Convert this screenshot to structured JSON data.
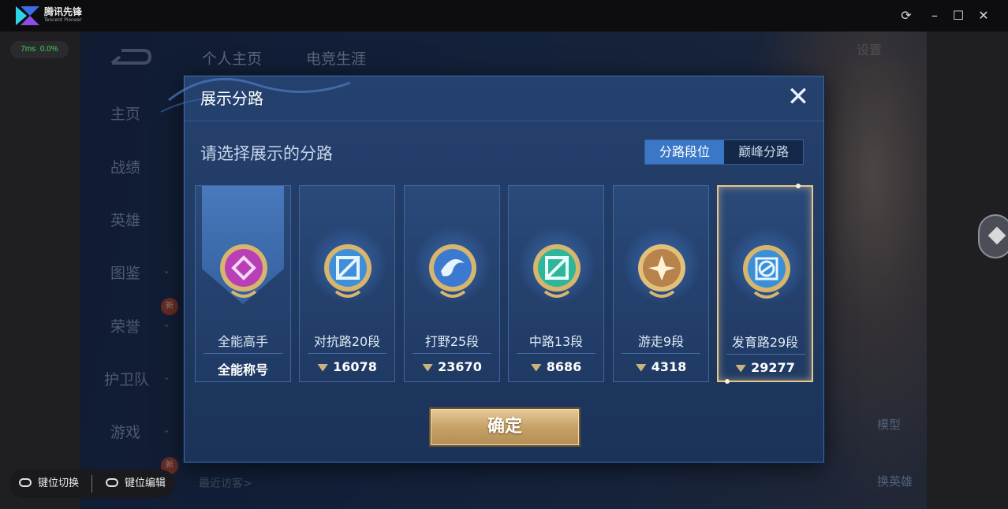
{
  "app": {
    "brand_name": "腾讯先锋",
    "brand_sub": "Tencent Pioneer"
  },
  "perf": {
    "ping": "7ms",
    "loss": "0.0%"
  },
  "window_controls": [
    "refresh-icon",
    "minimize-icon",
    "maximize-icon",
    "close-icon"
  ],
  "background": {
    "tabs": [
      "个人主页",
      "电竞生涯"
    ],
    "nav": [
      {
        "label": "主页"
      },
      {
        "label": "战绩"
      },
      {
        "label": "英雄"
      },
      {
        "label": "图鉴"
      },
      {
        "label": "荣誉",
        "badge": "新"
      },
      {
        "label": "护卫队"
      },
      {
        "label": "游戏",
        "badge": "新"
      }
    ],
    "settings": "设置",
    "side_labels": [
      "模型",
      "换英雄"
    ],
    "visitors": "最近访客>"
  },
  "modal": {
    "title": "展示分路",
    "subtitle": "请选择展示的分路",
    "toggle": {
      "active": "分路段位",
      "inactive": "巅峰分路"
    },
    "cards": [
      {
        "name": "全能高手",
        "value": "全能称号",
        "emblem_color": "#b93fb7",
        "selected": false,
        "allround": true
      },
      {
        "name": "对抗路20段",
        "value": "16078",
        "emblem_color": "#3f8fd8",
        "selected": false
      },
      {
        "name": "打野25段",
        "value": "23670",
        "emblem_color": "#3b7ad0",
        "selected": false
      },
      {
        "name": "中路13段",
        "value": "8686",
        "emblem_color": "#2fb59a",
        "selected": false
      },
      {
        "name": "游走9段",
        "value": "4318",
        "emblem_color": "#b7834a",
        "selected": false
      },
      {
        "name": "发育路29段",
        "value": "29277",
        "emblem_color": "#3b8fd8",
        "selected": true
      }
    ],
    "confirm": "确定"
  },
  "keymap": {
    "switch": "键位切换",
    "edit": "键位编辑"
  },
  "colors": {
    "accent_gold": "#e6c58c",
    "panel_blue": "#25416e",
    "toggle_active": "#3a77c7"
  }
}
